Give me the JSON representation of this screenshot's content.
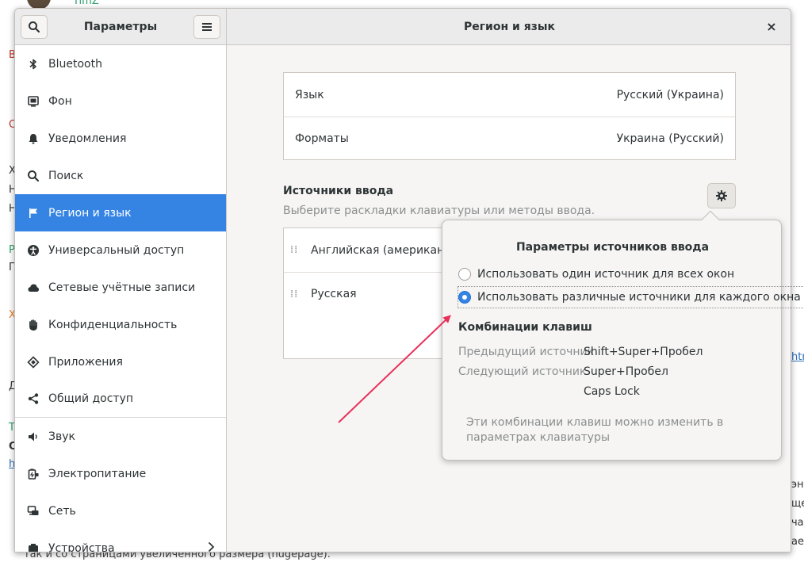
{
  "background": {
    "user_name": "TimZ",
    "bottom_text": "так и со страницами увеличенного размера (hugepage).",
    "left_fragments": [
      "В",
      "С",
      "Х",
      "Н",
      "Н",
      "Р",
      "П",
      "Х",
      "Д",
      "Т",
      "С",
      "h"
    ],
    "right_fragments": [
      "htm",
      "энд",
      "ще",
      "час",
      "ает"
    ]
  },
  "headerbar": {
    "sidebar_title": "Параметры",
    "main_title": "Регион и язык",
    "close_symbol": "×"
  },
  "sidebar": {
    "items": [
      {
        "label": "Bluetooth",
        "icon": "bluetooth-icon"
      },
      {
        "label": "Фон",
        "icon": "background-icon"
      },
      {
        "label": "Уведомления",
        "icon": "bell-icon"
      },
      {
        "label": "Поиск",
        "icon": "search-icon"
      },
      {
        "label": "Регион и язык",
        "icon": "flag-icon",
        "active": true
      },
      {
        "label": "Универсальный доступ",
        "icon": "accessibility-icon"
      },
      {
        "label": "Сетевые учётные записи",
        "icon": "cloud-icon"
      },
      {
        "label": "Конфиденциальность",
        "icon": "hand-icon"
      },
      {
        "label": "Приложения",
        "icon": "apps-icon"
      },
      {
        "label": "Общий доступ",
        "icon": "share-icon"
      },
      {
        "label": "Звук",
        "icon": "speaker-icon"
      },
      {
        "label": "Электропитание",
        "icon": "power-icon"
      },
      {
        "label": "Сеть",
        "icon": "network-icon"
      },
      {
        "label": "Устройства",
        "icon": "devices-icon"
      }
    ]
  },
  "region": {
    "language_label": "Язык",
    "language_value": "Русский (Украина)",
    "formats_label": "Форматы",
    "formats_value": "Украина (Русский)"
  },
  "input_sources": {
    "title": "Источники ввода",
    "subtitle": "Выберите раскладки клавиатуры или методы ввода.",
    "sources": [
      "Английская (американская)",
      "Русская"
    ]
  },
  "popover": {
    "title": "Параметры источников ввода",
    "option_same": "Использовать один источник для всех окон",
    "option_per_window": "Использовать различные источники для каждого окна",
    "shortcuts_title": "Комбинации клавиш",
    "prev_label": "Предыдущий источник",
    "prev_value": "Shift+Super+Пробел",
    "next_label": "Следующий источник",
    "next_value": "Super+Пробел",
    "alt_value": "Caps Lock",
    "note": "Эти комбинации клавиш можно изменить в параметрах клавиатуры"
  },
  "colors": {
    "accent": "#3584e4",
    "annotation_arrow": "#e8305a"
  }
}
